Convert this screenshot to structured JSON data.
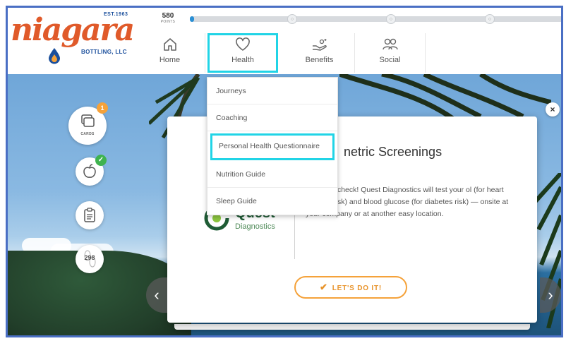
{
  "brand": {
    "wordmark": "niagara",
    "established": "EST.1963",
    "subtitle": "BOTTLING, LLC"
  },
  "points": {
    "value": "580",
    "label": "POINTS",
    "progress_fraction": 0.01,
    "milestones": [
      "○",
      "○",
      "○"
    ]
  },
  "nav": {
    "items": [
      {
        "label": "Home",
        "icon": "home-icon"
      },
      {
        "label": "Health",
        "icon": "heart-icon"
      },
      {
        "label": "Benefits",
        "icon": "hand-coins-icon"
      },
      {
        "label": "Social",
        "icon": "people-icon"
      }
    ],
    "active": "Health"
  },
  "dropdown": {
    "items": [
      "Journeys",
      "Coaching",
      "Personal Health Questionnaire",
      "Nutrition Guide",
      "Sleep Guide"
    ],
    "highlighted": "Personal Health Questionnaire"
  },
  "sidebar": {
    "cards_caption": "CARDS",
    "cards_badge": "1",
    "apple_badge": "✓",
    "steps_count": "298"
  },
  "card": {
    "title": "netric Screenings",
    "description": "ck health check! Quest Diagnostics will test your ol (for heart disease risk) and blood glucose (for diabetes risk) — onsite at your company or at another easy location.",
    "logo_word": "Quest",
    "logo_sub": "Diagnostics",
    "cta_label": "LET'S DO IT!",
    "close_label": "×",
    "prev_label": "‹",
    "next_label": "›"
  },
  "colors": {
    "brand_orange": "#e05a2a",
    "brand_blue": "#1b4f9c",
    "highlight_cyan": "#21d4e6",
    "cta_orange": "#f5a23a",
    "progress_blue": "#2a8fd4"
  }
}
